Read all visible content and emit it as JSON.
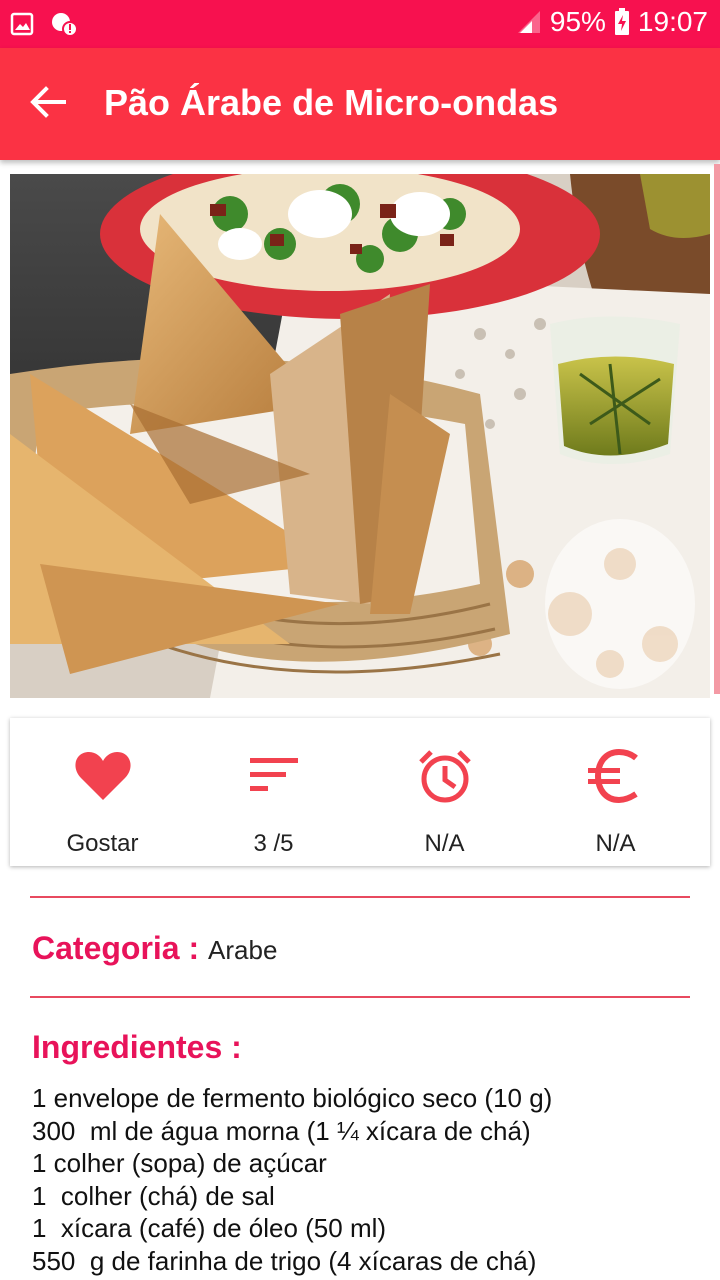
{
  "status_bar": {
    "battery": "95%",
    "time": "19:07",
    "icons": [
      "gallery-icon",
      "notification-icon",
      "signal-icon",
      "battery-charging-icon"
    ]
  },
  "app_bar": {
    "title": "Pão Árabe de Micro-ondas",
    "back_icon": "arrow-left-icon"
  },
  "stats": [
    {
      "icon": "heart-icon",
      "label": "Gostar"
    },
    {
      "icon": "difficulty-icon",
      "label": "3 /5"
    },
    {
      "icon": "alarm-clock-icon",
      "label": "N/A"
    },
    {
      "icon": "euro-icon",
      "label": "N/A"
    }
  ],
  "category": {
    "label": "Categoria :",
    "value": "Arabe"
  },
  "ingredients": {
    "label": "Ingredientes :",
    "items": [
      "1 envelope de fermento biológico seco (10 g)",
      "300  ml de água morna (1 ¼ xícara de chá)",
      "1 colher (sopa) de açúcar",
      "1  colher (chá) de sal",
      "1  xícara (café) de óleo (50 ml)",
      "550  g de farinha de trigo (4 xícaras de chá)"
    ]
  },
  "colors": {
    "status_bar": "#f7114f",
    "app_bar": "#fb3244",
    "accent": "#e8135a",
    "icon": "#f2424f"
  }
}
